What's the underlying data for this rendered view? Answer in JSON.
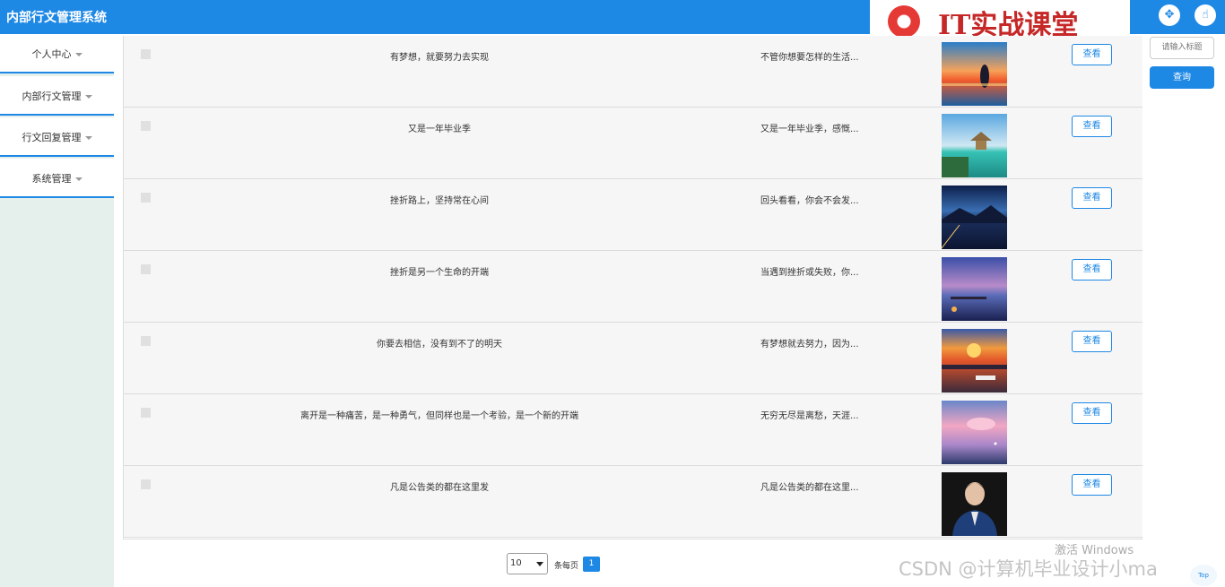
{
  "app": {
    "title": "内部行文管理系统"
  },
  "logo": {
    "text": "IT实战课堂"
  },
  "header": {
    "icons": [
      "fullscreen-icon",
      "user-icon"
    ]
  },
  "sidebar": {
    "items": [
      {
        "label": "个人中心"
      },
      {
        "label": "内部行文管理"
      },
      {
        "label": "行文回复管理"
      },
      {
        "label": "系统管理"
      }
    ]
  },
  "search": {
    "placeholder": "请输入标题",
    "button_label": "查询"
  },
  "table": {
    "view_label": "查看",
    "rows": [
      {
        "title": "有梦想，就要努力去实现",
        "brief": "不管你想要怎样的生活...",
        "thumb": "sunset-sea"
      },
      {
        "title": "又是一年毕业季",
        "brief": "又是一年毕业季，感慨...",
        "thumb": "tropical-island"
      },
      {
        "title": "挫折路上，坚持常在心间",
        "brief": "回头看看，你会不会发...",
        "thumb": "night-lake"
      },
      {
        "title": "挫折是另一个生命的开端",
        "brief": "当遇到挫折或失败，你...",
        "thumb": "twilight-pier"
      },
      {
        "title": "你要去相信，没有到不了的明天",
        "brief": "有梦想就去努力，因为...",
        "thumb": "sunset-harbor"
      },
      {
        "title": "离开是一种痛苦，是一种勇气，但同样也是一个考验，是一个新的开端",
        "brief": "无穷无尽是离愁，天涯...",
        "thumb": "pink-sky"
      },
      {
        "title": "凡是公告类的都在这里发",
        "brief": "凡是公告类的都在这里...",
        "thumb": "portrait"
      }
    ]
  },
  "pagination": {
    "page_size": "10",
    "per_page_label": "条每页",
    "current_page": "1"
  },
  "watermark": {
    "windows": "激活 Windows",
    "csdn": "CSDN @计算机毕业设计小ma"
  },
  "back_to_top": "Top",
  "colors": {
    "primary": "#1e88e5",
    "sidebar_bg": "#e5efeb",
    "row_bg": "#f6f6f6"
  }
}
